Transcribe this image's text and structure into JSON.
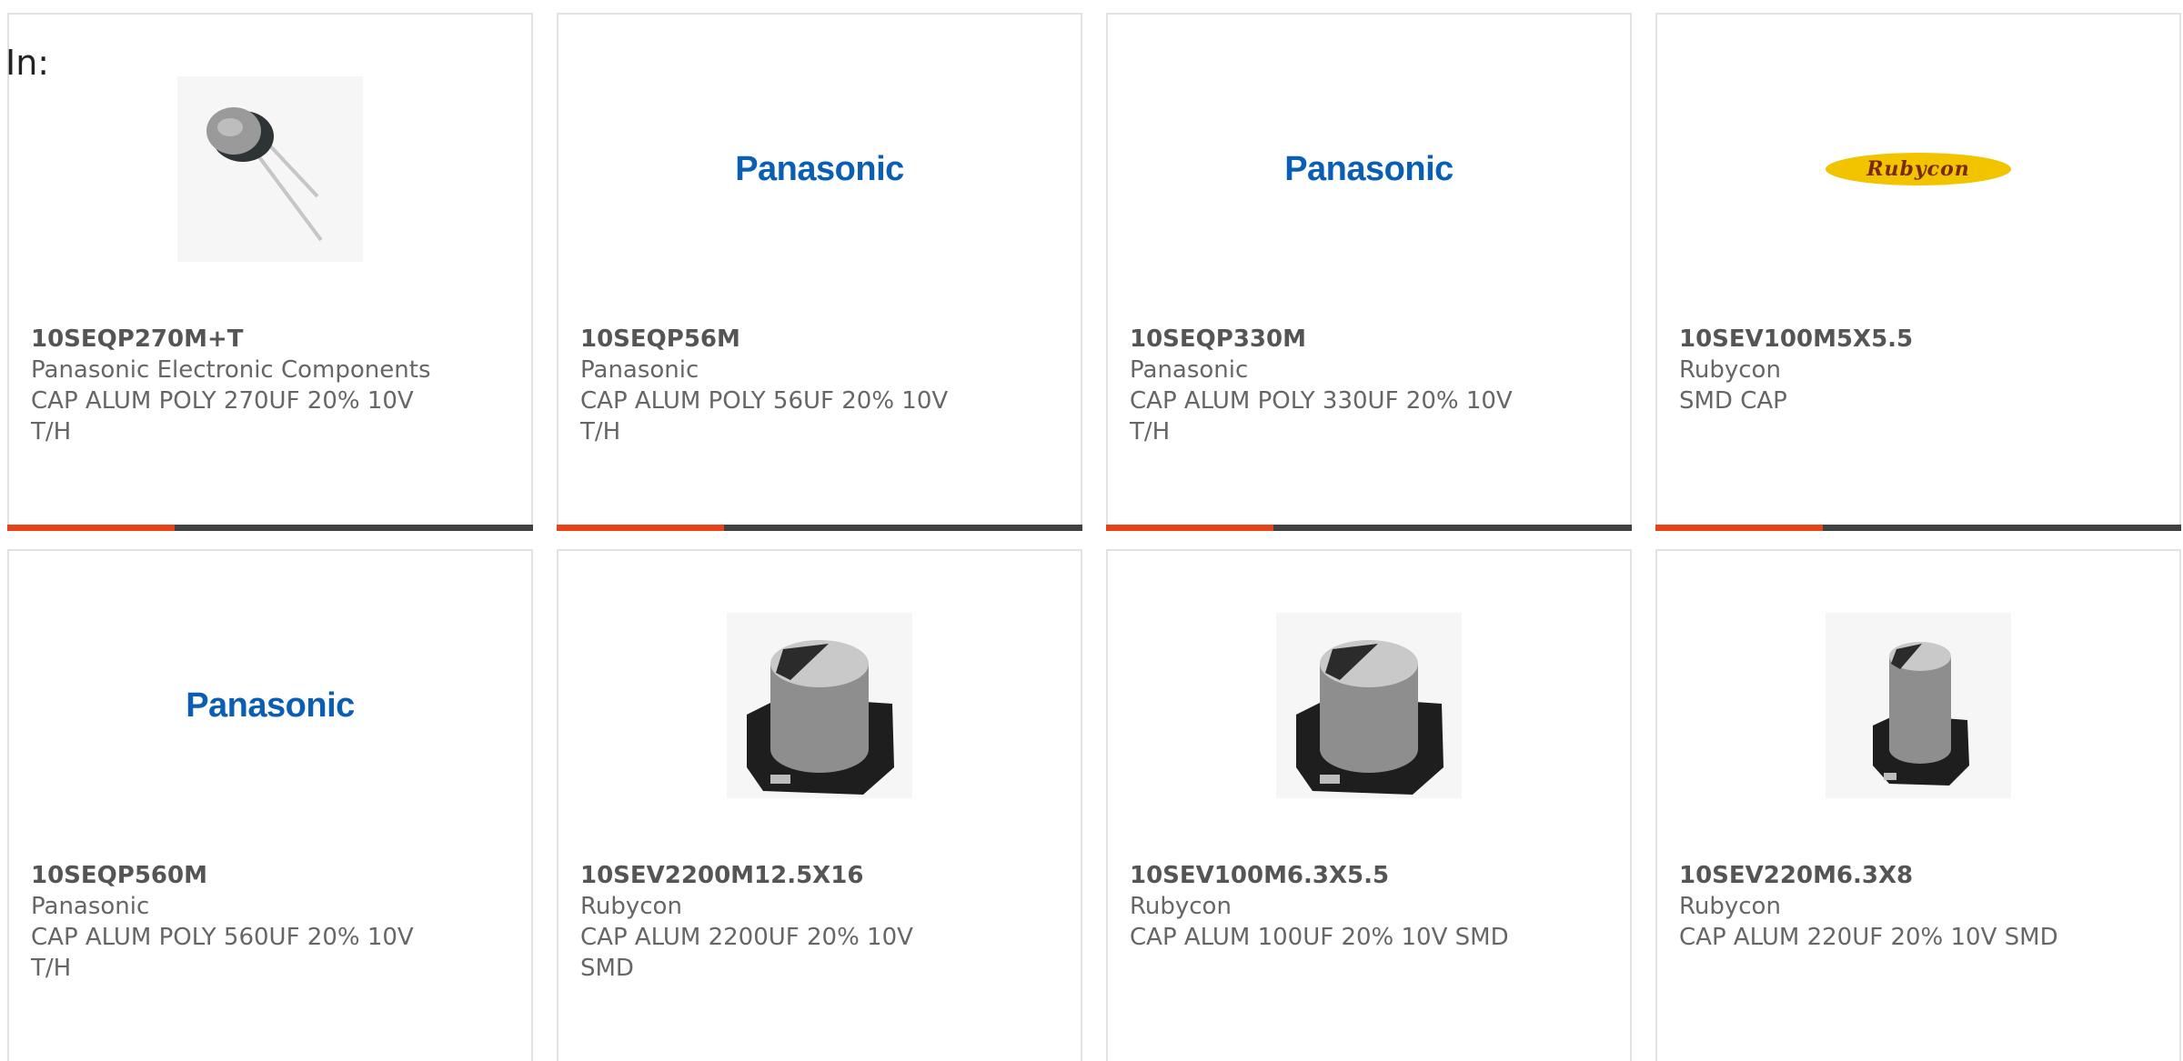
{
  "header": {
    "in_label": "In:"
  },
  "colors": {
    "accent": "#e8421b",
    "bar": "#414141",
    "panasonic_blue": "#0a5fb4",
    "rubycon_yellow": "#f2c400"
  },
  "products": [
    {
      "part_number": "10SEQP270M+T",
      "manufacturer": "Panasonic Electronic Components",
      "description": "CAP ALUM POLY 270UF 20% 10V T/H",
      "image": "radial-capacitor-photo"
    },
    {
      "part_number": "10SEQP56M",
      "manufacturer": "Panasonic",
      "description": "CAP ALUM POLY 56UF 20% 10V T/H",
      "image": "panasonic-logo",
      "logo_text": "Panasonic"
    },
    {
      "part_number": "10SEQP330M",
      "manufacturer": "Panasonic",
      "description": "CAP ALUM POLY 330UF 20% 10V T/H",
      "image": "panasonic-logo",
      "logo_text": "Panasonic"
    },
    {
      "part_number": "10SEV100M5X5.5",
      "manufacturer": "Rubycon",
      "description": "SMD CAP",
      "image": "rubycon-logo",
      "logo_text": "Rubycon"
    },
    {
      "part_number": "10SEQP560M",
      "manufacturer": "Panasonic",
      "description": "CAP ALUM POLY 560UF 20% 10V T/H",
      "image": "panasonic-logo",
      "logo_text": "Panasonic"
    },
    {
      "part_number": "10SEV2200M12.5X16",
      "manufacturer": "Rubycon",
      "description": "CAP ALUM 2200UF 20% 10V SMD",
      "image": "smd-capacitor-photo"
    },
    {
      "part_number": "10SEV100M6.3X5.5",
      "manufacturer": "Rubycon",
      "description": "CAP ALUM 100UF 20% 10V SMD",
      "image": "smd-capacitor-photo"
    },
    {
      "part_number": "10SEV220M6.3X8",
      "manufacturer": "Rubycon",
      "description": "CAP ALUM 220UF 20% 10V SMD",
      "image": "smd-capacitor-small-photo"
    }
  ]
}
